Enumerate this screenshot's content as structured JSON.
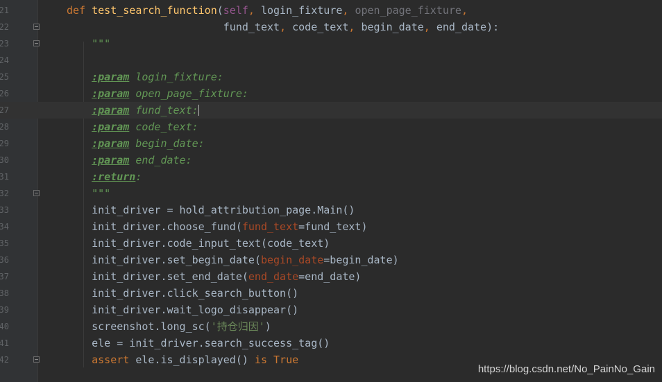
{
  "lines": [
    {
      "n": "21",
      "segments": [
        [
          "kw",
          "def "
        ],
        [
          "fn",
          "test_search_function"
        ],
        [
          "param",
          "("
        ],
        [
          "self",
          "self"
        ],
        [
          "punc",
          ", "
        ],
        [
          "param",
          "login_fixture"
        ],
        [
          "punc",
          ", "
        ],
        [
          "unused",
          "open_page_fixture"
        ],
        [
          "punc",
          ","
        ]
      ]
    },
    {
      "n": "22",
      "fold": true,
      "segments": [
        [
          "param",
          "                         fund_text"
        ],
        [
          "punc",
          ", "
        ],
        [
          "param",
          "code_text"
        ],
        [
          "punc",
          ", "
        ],
        [
          "param",
          "begin_date"
        ],
        [
          "punc",
          ", "
        ],
        [
          "param",
          "end_date):"
        ]
      ]
    },
    {
      "n": "23",
      "fold": true,
      "segments": [
        [
          "doc",
          "    \"\"\""
        ]
      ]
    },
    {
      "n": "24",
      "segments": []
    },
    {
      "n": "25",
      "segments": [
        [
          "doc",
          "    "
        ],
        [
          "doctag",
          ":param"
        ],
        [
          "doc",
          " login_fixture:"
        ]
      ]
    },
    {
      "n": "26",
      "segments": [
        [
          "doc",
          "    "
        ],
        [
          "doctag",
          ":param"
        ],
        [
          "doc",
          " open_page_fixture:"
        ]
      ]
    },
    {
      "n": "27",
      "current": true,
      "segments": [
        [
          "doc",
          "    "
        ],
        [
          "doctag",
          ":param"
        ],
        [
          "doc",
          " fund_text:"
        ]
      ]
    },
    {
      "n": "28",
      "segments": [
        [
          "doc",
          "    "
        ],
        [
          "doctag",
          ":param"
        ],
        [
          "doc",
          " code_text:"
        ]
      ]
    },
    {
      "n": "29",
      "segments": [
        [
          "doc",
          "    "
        ],
        [
          "doctag",
          ":param"
        ],
        [
          "doc",
          " begin_date:"
        ]
      ]
    },
    {
      "n": "30",
      "segments": [
        [
          "doc",
          "    "
        ],
        [
          "doctag",
          ":param"
        ],
        [
          "doc",
          " end_date:"
        ]
      ]
    },
    {
      "n": "31",
      "segments": [
        [
          "doc",
          "    "
        ],
        [
          "doctag",
          ":return"
        ],
        [
          "doc",
          ":"
        ]
      ]
    },
    {
      "n": "32",
      "fold": true,
      "segments": [
        [
          "doc",
          "    \"\"\""
        ]
      ]
    },
    {
      "n": "33",
      "segments": [
        [
          "param",
          "    init_driver = hold_attribution_page.Main()"
        ]
      ]
    },
    {
      "n": "34",
      "segments": [
        [
          "param",
          "    init_driver.choose_fund("
        ],
        [
          "kwarg",
          "fund_text"
        ],
        [
          "param",
          "=fund_text)"
        ]
      ]
    },
    {
      "n": "35",
      "segments": [
        [
          "param",
          "    init_driver.code_input_text(code_text)"
        ]
      ]
    },
    {
      "n": "36",
      "segments": [
        [
          "param",
          "    init_driver.set_begin_date("
        ],
        [
          "kwarg",
          "begin_date"
        ],
        [
          "param",
          "=begin_date)"
        ]
      ]
    },
    {
      "n": "37",
      "segments": [
        [
          "param",
          "    init_driver.set_end_date("
        ],
        [
          "kwarg",
          "end_date"
        ],
        [
          "param",
          "=end_date)"
        ]
      ]
    },
    {
      "n": "38",
      "segments": [
        [
          "param",
          "    init_driver.click_search_button()"
        ]
      ]
    },
    {
      "n": "39",
      "segments": [
        [
          "param",
          "    init_driver.wait_logo_disappear()"
        ]
      ]
    },
    {
      "n": "40",
      "segments": [
        [
          "param",
          "    screenshot.long_sc("
        ],
        [
          "str",
          "'持仓归因'"
        ],
        [
          "param",
          ")"
        ]
      ]
    },
    {
      "n": "41",
      "segments": [
        [
          "param",
          "    ele = init_driver.search_success_tag()"
        ]
      ]
    },
    {
      "n": "42",
      "fold": true,
      "segments": [
        [
          "kw",
          "    assert "
        ],
        [
          "param",
          "ele.is_displayed() "
        ],
        [
          "kw",
          "is True"
        ]
      ]
    }
  ],
  "watermark": "https://blog.csdn.net/No_PainNo_Gain"
}
